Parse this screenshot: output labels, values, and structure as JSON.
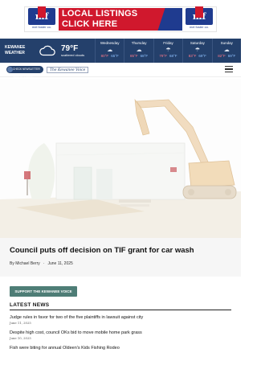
{
  "ad": {
    "logo_text": "mf",
    "logo_sub": "mel foster co.",
    "line1": "LOCAL LISTINGS",
    "line2": "CLICK HERE"
  },
  "weather": {
    "city": "KEWANEE",
    "label": "WEATHER",
    "current_temp": "79°F",
    "current_condition": "scattered clouds",
    "days": [
      {
        "name": "Wednesday",
        "high": "80°F",
        "low": "65°F",
        "icon": "cloud-icon"
      },
      {
        "name": "Thursday",
        "high": "85°F",
        "low": "68°F",
        "icon": "cloud-icon"
      },
      {
        "name": "Friday",
        "high": "79°F",
        "low": "68°F",
        "icon": "rain-icon"
      },
      {
        "name": "Saturday",
        "high": "83°F",
        "low": "69°F",
        "icon": "rain-icon"
      },
      {
        "name": "Sunday",
        "high": "82°F",
        "low": "69°F",
        "icon": "cloud-icon"
      }
    ]
  },
  "header": {
    "badge": "CHECK NEWSLETTER SIGN UP TODAY!",
    "paper_name": "The Kewanee Voice"
  },
  "article": {
    "headline": "Council puts off decision on TIF grant for car wash",
    "author": "By Michael Berry",
    "date": "June 11, 2025"
  },
  "support_button": "SUPPORT THE KEWANEE VOICE",
  "latest": {
    "title": "LATEST NEWS",
    "items": [
      {
        "title": "Judge rules in favor for two of the five plaintiffs in lawsuit against city",
        "date": "June 11, 2025"
      },
      {
        "title": "Despite high cost, council OKs bid to move mobile home park grass",
        "date": "June 10, 2025"
      },
      {
        "title": "Fish were biting for annual Oldeen's Kids Fishing Rodeo",
        "date": ""
      }
    ]
  },
  "colors": {
    "navy": "#24406b",
    "ad_red": "#d0182d",
    "support_green": "#4e7d76"
  }
}
